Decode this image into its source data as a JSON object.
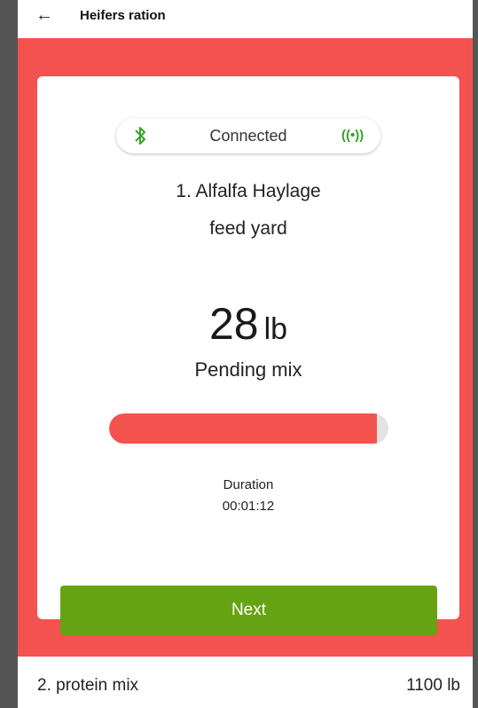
{
  "header": {
    "back_icon": "arrow-left-icon",
    "title": "Heifers ration"
  },
  "connection": {
    "bluetooth_icon": "bluetooth-icon",
    "label": "Connected",
    "signal_icon": "broadcast-signal-icon",
    "signal_glyph": "((•))"
  },
  "current_item": {
    "name": "1. Alfalfa Haylage",
    "location": "feed yard",
    "weight_value": "28",
    "weight_unit": "lb",
    "status": "Pending mix",
    "progress": 0.96,
    "duration_label": "Duration",
    "duration_value": "00:01:12"
  },
  "actions": {
    "next_label": "Next"
  },
  "next_item": {
    "name": "2. protein mix",
    "weight": "1100 lb"
  },
  "colors": {
    "accent_red": "#f4524f",
    "green": "#66a312",
    "bluetooth_green": "#3aa12a"
  }
}
